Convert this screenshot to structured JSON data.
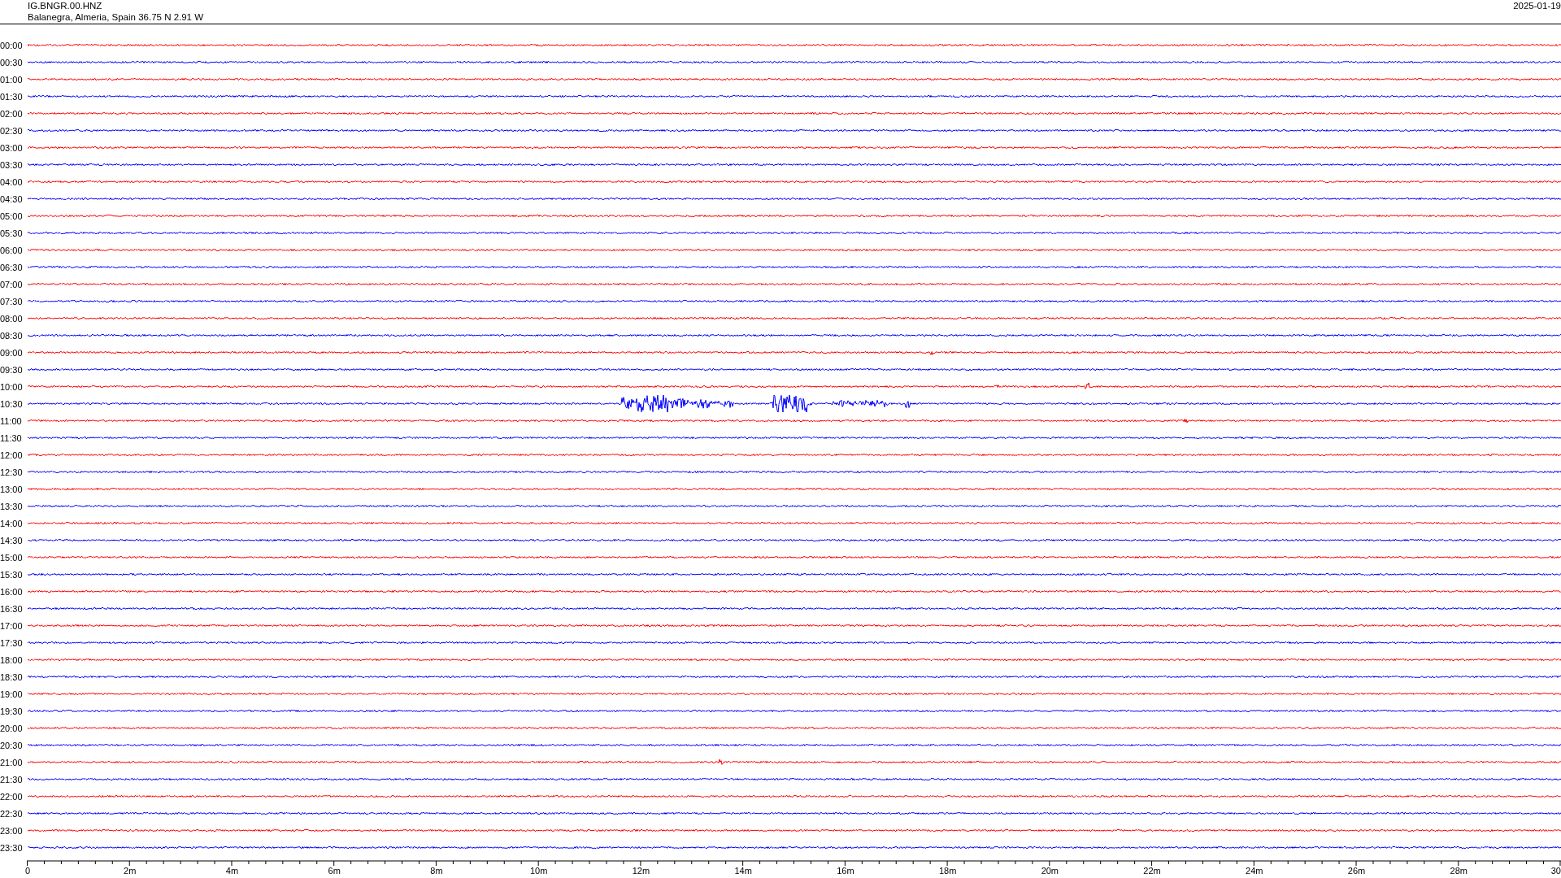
{
  "header": {
    "station": "IG.BNGR.00.HNZ",
    "location": "Balanegra, Almeria, Spain  36.75 N 2.91 W",
    "date": "2025-01-19"
  },
  "rows": [
    {
      "time": "00:00",
      "color": "#ff0000"
    },
    {
      "time": "00:30",
      "color": "#0000ff"
    },
    {
      "time": "01:00",
      "color": "#ff0000"
    },
    {
      "time": "01:30",
      "color": "#0000ff"
    },
    {
      "time": "02:00",
      "color": "#ff0000"
    },
    {
      "time": "02:30",
      "color": "#0000ff"
    },
    {
      "time": "03:00",
      "color": "#ff0000"
    },
    {
      "time": "03:30",
      "color": "#0000ff"
    },
    {
      "time": "04:00",
      "color": "#ff0000"
    },
    {
      "time": "04:30",
      "color": "#0000ff"
    },
    {
      "time": "05:00",
      "color": "#ff0000"
    },
    {
      "time": "05:30",
      "color": "#0000ff"
    },
    {
      "time": "06:00",
      "color": "#ff0000"
    },
    {
      "time": "06:30",
      "color": "#0000ff"
    },
    {
      "time": "07:00",
      "color": "#ff0000"
    },
    {
      "time": "07:30",
      "color": "#0000ff"
    },
    {
      "time": "08:00",
      "color": "#ff0000"
    },
    {
      "time": "08:30",
      "color": "#0000ff"
    },
    {
      "time": "09:00",
      "color": "#ff0000"
    },
    {
      "time": "09:30",
      "color": "#0000ff"
    },
    {
      "time": "10:00",
      "color": "#ff0000"
    },
    {
      "time": "10:30",
      "color": "#0000ff"
    },
    {
      "time": "11:00",
      "color": "#ff0000"
    },
    {
      "time": "11:30",
      "color": "#0000ff"
    },
    {
      "time": "12:00",
      "color": "#ff0000"
    },
    {
      "time": "12:30",
      "color": "#0000ff"
    },
    {
      "time": "13:00",
      "color": "#ff0000"
    },
    {
      "time": "13:30",
      "color": "#0000ff"
    },
    {
      "time": "14:00",
      "color": "#ff0000"
    },
    {
      "time": "14:30",
      "color": "#0000ff"
    },
    {
      "time": "15:00",
      "color": "#ff0000"
    },
    {
      "time": "15:30",
      "color": "#0000ff"
    },
    {
      "time": "16:00",
      "color": "#ff0000"
    },
    {
      "time": "16:30",
      "color": "#0000ff"
    },
    {
      "time": "17:00",
      "color": "#ff0000"
    },
    {
      "time": "17:30",
      "color": "#0000ff"
    },
    {
      "time": "18:00",
      "color": "#ff0000"
    },
    {
      "time": "18:30",
      "color": "#0000ff"
    },
    {
      "time": "19:00",
      "color": "#ff0000"
    },
    {
      "time": "19:30",
      "color": "#0000ff"
    },
    {
      "time": "20:00",
      "color": "#ff0000"
    },
    {
      "time": "20:30",
      "color": "#0000ff"
    },
    {
      "time": "21:00",
      "color": "#ff0000"
    },
    {
      "time": "21:30",
      "color": "#0000ff"
    },
    {
      "time": "22:00",
      "color": "#ff0000"
    },
    {
      "time": "22:30",
      "color": "#0000ff"
    },
    {
      "time": "23:00",
      "color": "#ff0000"
    },
    {
      "time": "23:30",
      "color": "#0000ff"
    }
  ],
  "axis_labels": [
    "0",
    "2m",
    "4m",
    "6m",
    "8m",
    "10m",
    "12m",
    "14m",
    "16m",
    "18m",
    "20m",
    "22m",
    "24m",
    "26m",
    "28m",
    "30"
  ]
}
